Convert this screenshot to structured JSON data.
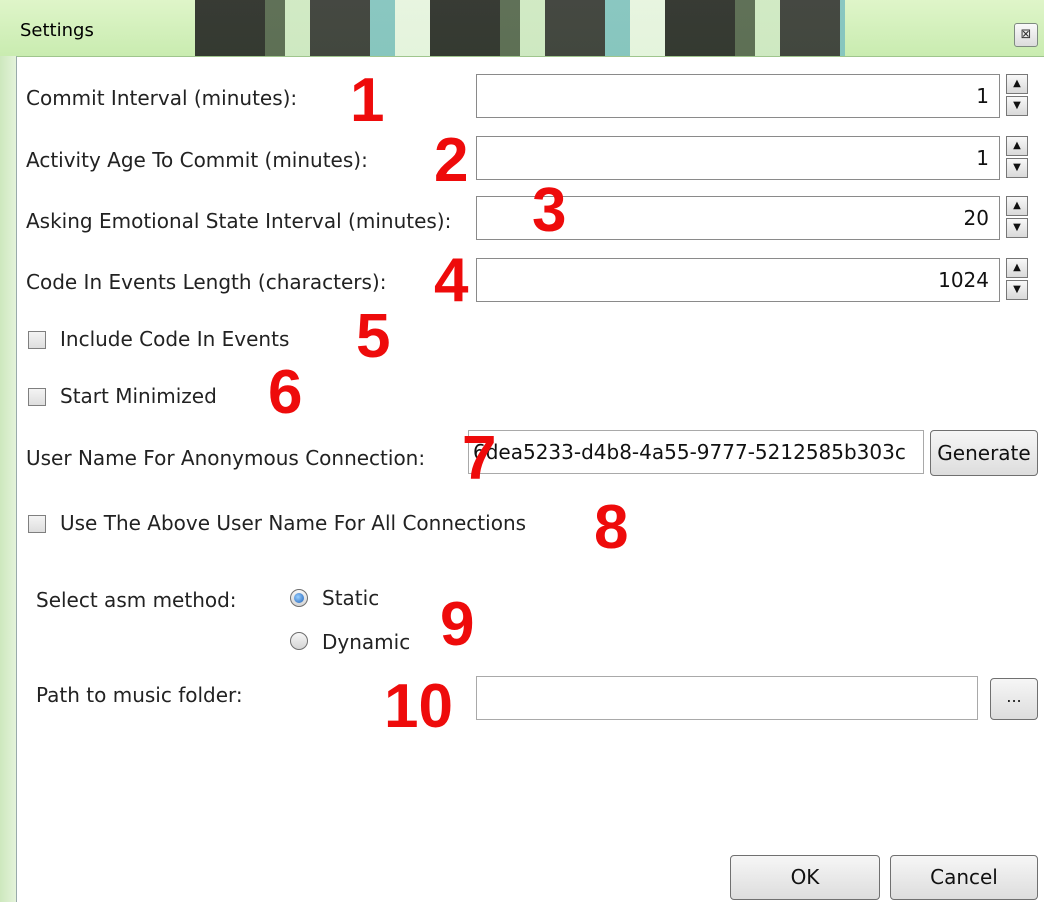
{
  "window": {
    "title": "Settings",
    "close_glyph": "⊠"
  },
  "fields": [
    {
      "label": "Commit Interval (minutes):",
      "value": "1"
    },
    {
      "label": "Activity Age To Commit (minutes):",
      "value": "1"
    },
    {
      "label": "Asking Emotional State Interval (minutes):",
      "value": "20"
    },
    {
      "label": "Code In Events Length (characters):",
      "value": "1024"
    }
  ],
  "checkboxes": {
    "include_code": {
      "label": "Include Code In Events",
      "checked": false
    },
    "start_minimized": {
      "label": "Start Minimized",
      "checked": false
    },
    "use_username_all": {
      "label": "Use The Above User Name For All Connections",
      "checked": false
    }
  },
  "username": {
    "label": "User Name For Anonymous Connection:",
    "value": "6dea5233-d4b8-4a55-9777-5212585b303c",
    "generate_label": "Generate"
  },
  "asm_method": {
    "label": "Select asm method:",
    "options": [
      {
        "label": "Static",
        "selected": true
      },
      {
        "label": "Dynamic",
        "selected": false
      }
    ]
  },
  "music_path": {
    "label": "Path to music folder:",
    "value": "",
    "browse_label": "..."
  },
  "buttons": {
    "ok": "OK",
    "cancel": "Cancel"
  },
  "markers": [
    "1",
    "2",
    "3",
    "4",
    "5",
    "6",
    "7",
    "8",
    "9",
    "10"
  ],
  "colors": {
    "marker": "#ee0b0b",
    "titlebar": "#d6f1c2",
    "radio_selected": "#1c5fb8"
  },
  "icons": {
    "spin_up": "▲",
    "spin_down": "▼"
  }
}
